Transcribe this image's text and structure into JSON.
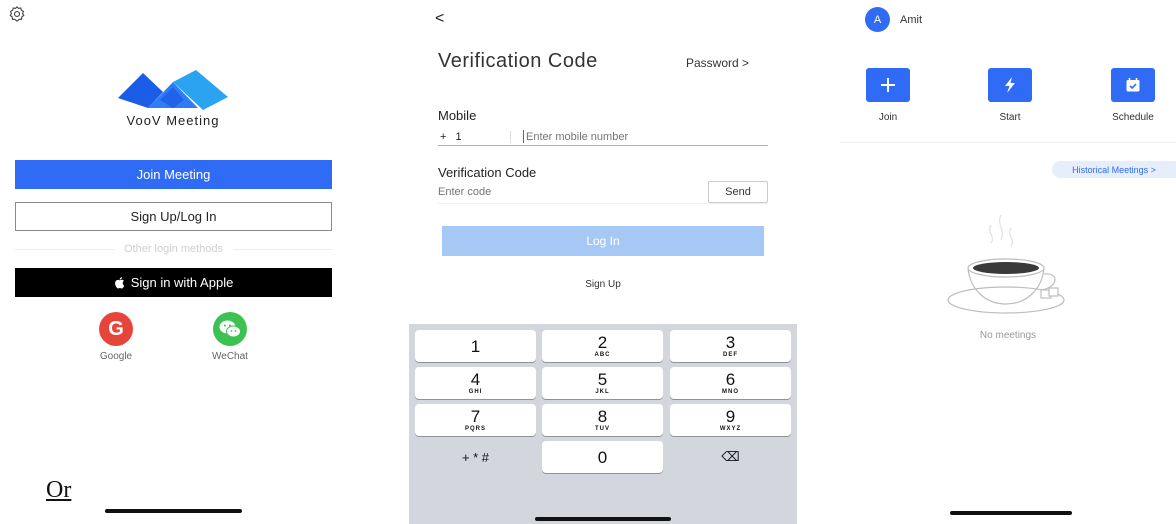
{
  "login_screen": {
    "brand_name": "VooV Meeting",
    "join_meeting_label": "Join Meeting",
    "signup_login_label": "Sign Up/Log In",
    "other_methods_label": "Other login methods",
    "apple_label": "Sign in with Apple",
    "google_label": "Google",
    "google_glyph": "G",
    "wechat_label": "WeChat",
    "or_text": "Or",
    "brand_color": "#2f6bf5"
  },
  "verification_screen": {
    "back_glyph": "<",
    "title": "Verification Code",
    "password_link": "Password  >",
    "mobile_label": "Mobile",
    "country_code": "+ 1",
    "mobile_placeholder": "Enter mobile number",
    "code_label": "Verification Code",
    "code_placeholder": "Enter code",
    "send_label": "Send",
    "login_label": "Log In",
    "signup_label": "Sign Up",
    "keypad": [
      {
        "num": "1",
        "letters": ""
      },
      {
        "num": "2",
        "letters": "ABC"
      },
      {
        "num": "3",
        "letters": "DEF"
      },
      {
        "num": "4",
        "letters": "GHI"
      },
      {
        "num": "5",
        "letters": "JKL"
      },
      {
        "num": "6",
        "letters": "MNO"
      },
      {
        "num": "7",
        "letters": "PQRS"
      },
      {
        "num": "8",
        "letters": "TUV"
      },
      {
        "num": "9",
        "letters": "WXYZ"
      },
      {
        "num": "+ * #",
        "letters": ""
      },
      {
        "num": "0",
        "letters": ""
      },
      {
        "num": "⌫",
        "letters": ""
      }
    ]
  },
  "home_screen": {
    "avatar_initial": "A",
    "user_name": "Amit",
    "actions": {
      "join": {
        "label": "Join",
        "icon": "plus-icon"
      },
      "start": {
        "label": "Start",
        "icon": "lightning-icon"
      },
      "schedule": {
        "label": "Schedule",
        "icon": "calendar-check-icon"
      }
    },
    "historical_label": "Historical Meetings >",
    "empty_label": "No meetings"
  }
}
